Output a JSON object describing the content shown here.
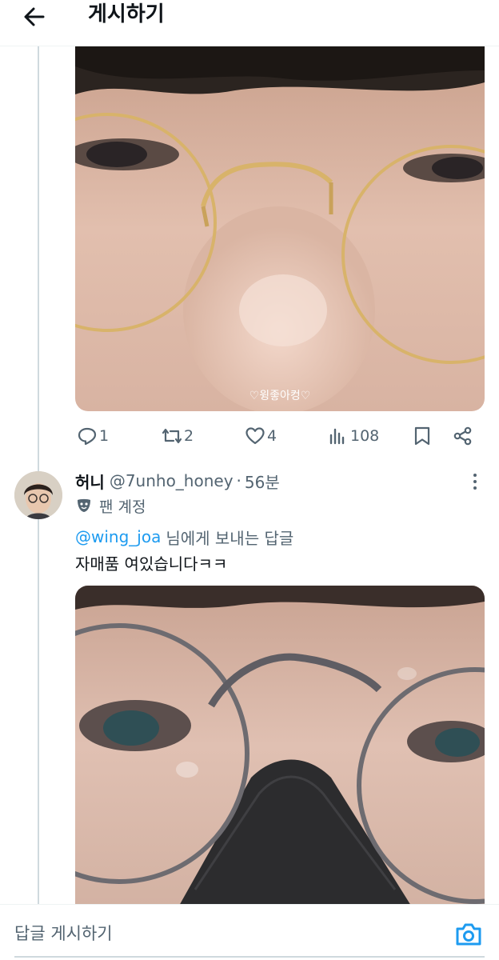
{
  "header": {
    "title": "게시하기",
    "back_icon": "arrow-left-icon"
  },
  "first_post": {
    "photo_watermark": "♡윙좋아컹♡",
    "actions": {
      "reply_count": "1",
      "retweet_count": "2",
      "like_count": "4",
      "view_count": "108"
    }
  },
  "reply": {
    "display_name": "허니",
    "handle": "@7unho_honey",
    "separator": "·",
    "time": "56분",
    "badge": "팬 계정",
    "mention": "@wing_joa",
    "reply_to_suffix": "님에게 보내는 답글",
    "text": "자매품 여있습니다ㅋㅋ"
  },
  "composer": {
    "placeholder": "답글 게시하기"
  },
  "colors": {
    "accent": "#1d9bf0",
    "secondary_text": "#536471",
    "divider": "#eff3f4"
  }
}
